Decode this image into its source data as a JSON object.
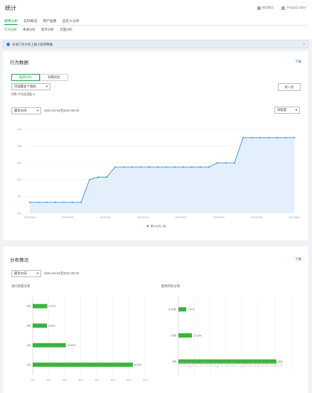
{
  "page": {
    "title": "统计",
    "report_link": "使用报告",
    "custom_stats": "手动自定义统计"
  },
  "tabs": [
    "使用分析",
    "实时概况",
    "用户画像",
    "自定义分析"
  ],
  "subtabs": [
    "行为分析",
    "来源分析",
    "留存分析",
    "页面分析"
  ],
  "notice": {
    "text": "开发行为分析上报小程序数据",
    "close": "×"
  },
  "behavior": {
    "title": "行为数据",
    "download": "下载",
    "seg": [
      "趋势对比",
      "对照对比"
    ],
    "select_placeholder": "可选最多个指标",
    "option_label": "同等+平均信息值 ☑",
    "compare_btn": "对一比",
    "range_select": "最近30天",
    "date_range": "2021-04-04至2021-05-03",
    "granularity": "日粒度"
  },
  "chart_data": {
    "type": "line",
    "ylabel": "",
    "xlabel": "",
    "y_ticks": [
      "760",
      "762",
      "764",
      "766",
      "768",
      "770"
    ],
    "ylim": [
      760,
      770
    ],
    "x_ticks": [
      "2021/04/04",
      "2021/04/08",
      "2021/04/12",
      "2021/04/16",
      "2021/04/20",
      "2021/04/24",
      "2021/04/28",
      "2021/05/03"
    ],
    "series": [
      {
        "name": "累计访问人数",
        "color": "#3b8de0",
        "values": [
          761.3,
          761.3,
          761.3,
          761.3,
          761.3,
          761.3,
          761.3,
          764,
          764.3,
          764.3,
          765.5,
          765.5,
          765.5,
          765.5,
          765.5,
          765.5,
          765.5,
          765.5,
          765.5,
          765.5,
          765.5,
          765.5,
          766,
          766,
          766,
          769,
          769,
          769,
          769,
          769,
          769,
          769
        ]
      }
    ],
    "grid": true,
    "legend": "bottom"
  },
  "dist": {
    "title": "分布情况",
    "download": "下载",
    "range_select": "最近30天",
    "date_range": "2021-04-04至2021-05-03",
    "left_title": "访问深度分布",
    "right_title": "使用时长分布"
  },
  "left_bars": {
    "categories": [
      "4页",
      "3页",
      "2页",
      "1页"
    ],
    "values": [
      9.13,
      8.89,
      20.65,
      62.5
    ],
    "labels": [
      "9.13%",
      "8.89%",
      "20.65%",
      "62.5%"
    ],
    "x_ticks": [
      "0%",
      "10%",
      "20%",
      "30%",
      "40%",
      "50%",
      "60%",
      "70%"
    ]
  },
  "right_bars": {
    "categories": [
      "6-10秒",
      "1-5秒",
      "0秒"
    ],
    "values": [
      7.67,
      13.33,
      96
    ],
    "labels": [
      "7.67%",
      "13.33%",
      "96%"
    ]
  },
  "watermark": "https://blog.csdn.net/stdonald"
}
